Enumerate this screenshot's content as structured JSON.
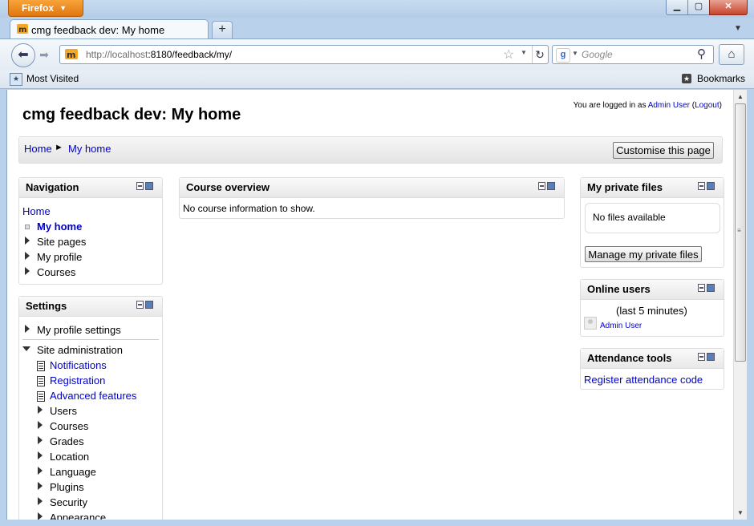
{
  "browser": {
    "app_button": "Firefox",
    "tab_title": "cmg feedback dev: My home",
    "url_host": "http://localhost",
    "url_rest": ":8180/feedback/my/",
    "search_placeholder": "Google",
    "bookmarks_left": "Most Visited",
    "bookmarks_right": "Bookmarks"
  },
  "page": {
    "login_prefix": "You are logged in as ",
    "login_user": "Admin User",
    "login_logout_open": " (",
    "login_logout": "Logout",
    "login_logout_close": ")",
    "title": "cmg feedback dev: My home",
    "breadcrumb": {
      "home": "Home",
      "sep": "►",
      "current": "My home"
    },
    "customise_button": "Customise this page"
  },
  "navigation": {
    "title": "Navigation",
    "home": "Home",
    "items": [
      "My home",
      "Site pages",
      "My profile",
      "Courses"
    ]
  },
  "settings": {
    "title": "Settings",
    "my_profile_settings": "My profile settings",
    "site_admin": "Site administration",
    "doc_items": [
      "Notifications",
      "Registration",
      "Advanced features"
    ],
    "sub_items": [
      "Users",
      "Courses",
      "Grades",
      "Location",
      "Language",
      "Plugins",
      "Security",
      "Appearance"
    ]
  },
  "course_overview": {
    "title": "Course overview",
    "message": "No course information to show."
  },
  "private_files": {
    "title": "My private files",
    "message": "No files available",
    "button": "Manage my private files"
  },
  "online_users": {
    "title": "Online users",
    "period": "(last 5 minutes)",
    "user": "Admin User"
  },
  "attendance": {
    "title": "Attendance tools",
    "link": "Register attendance code"
  }
}
